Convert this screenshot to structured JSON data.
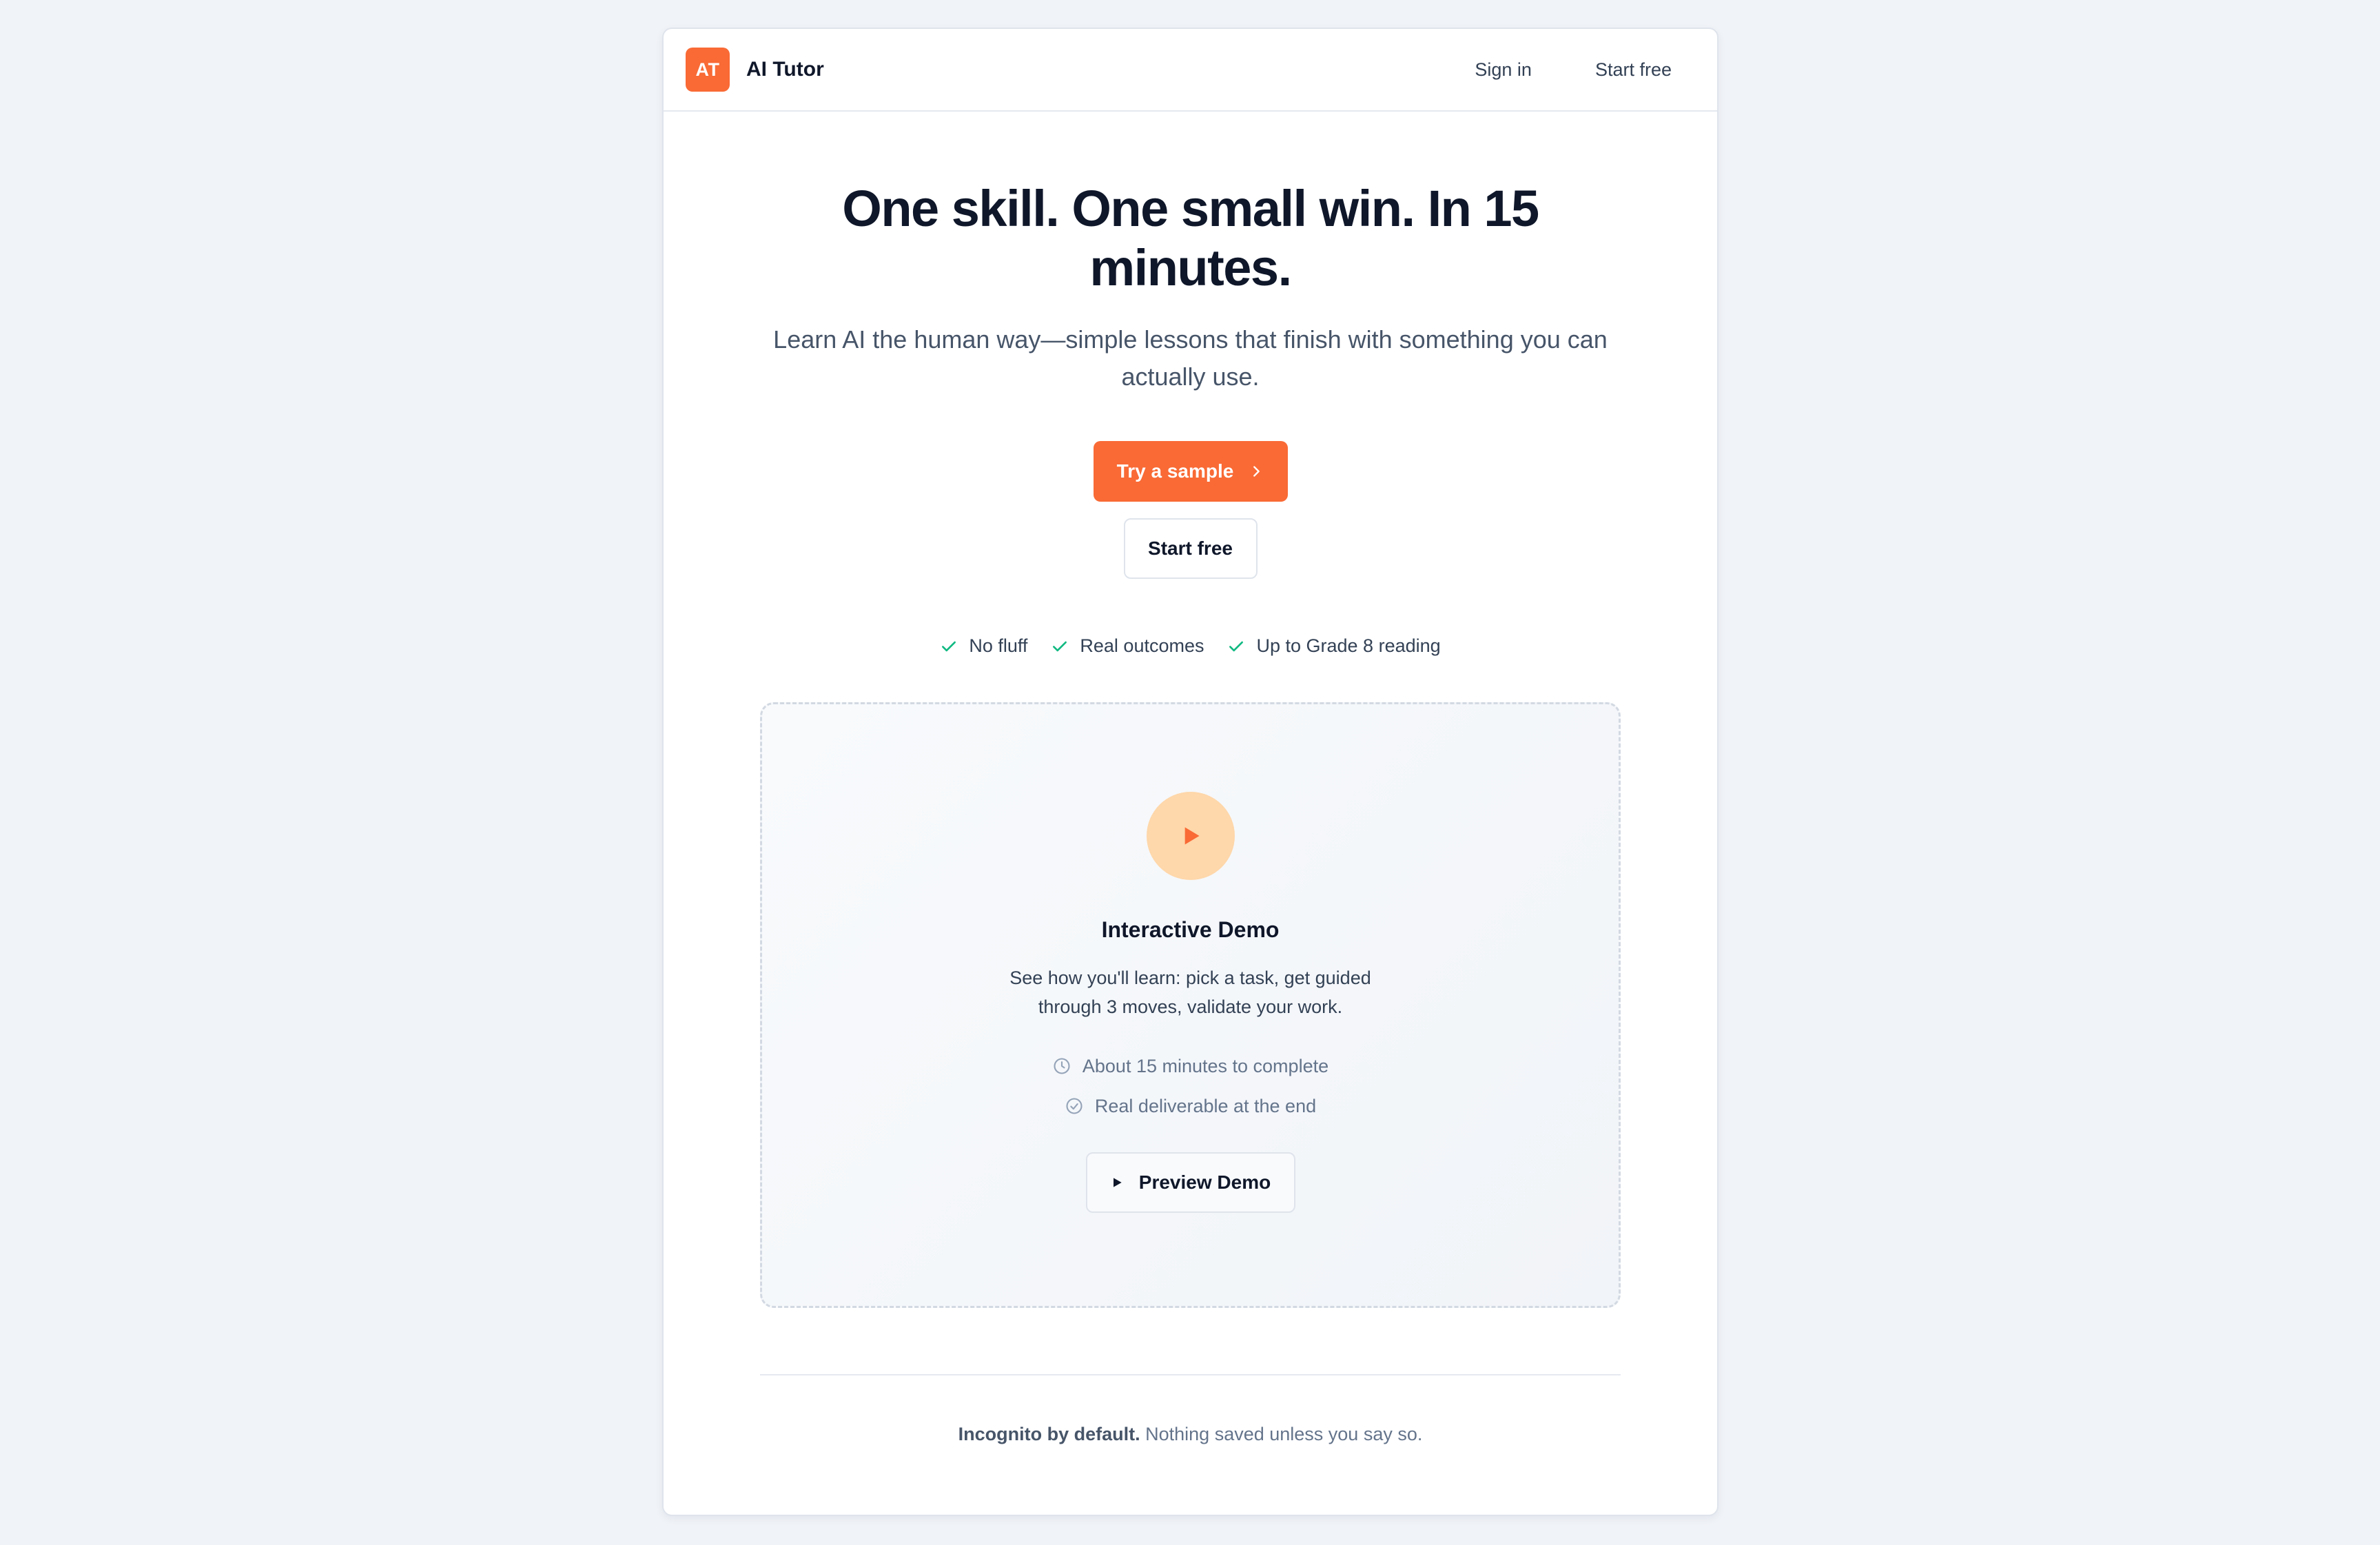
{
  "header": {
    "logo_text": "AT",
    "brand_name": "AI Tutor",
    "sign_in_label": "Sign in",
    "start_free_label": "Start free"
  },
  "hero": {
    "headline": "One skill. One small win. In 15 minutes.",
    "subheadline": "Learn AI the human way—simple lessons that finish with something you can actually use.",
    "primary_cta_label": "Try a sample",
    "secondary_cta_label": "Start free"
  },
  "features": [
    {
      "label": "No fluff",
      "icon": "check-icon"
    },
    {
      "label": "Real outcomes",
      "icon": "check-icon"
    },
    {
      "label": "Up to Grade 8 reading",
      "icon": "check-icon"
    }
  ],
  "demo": {
    "title": "Interactive Demo",
    "description": "See how you'll learn: pick a task, get guided through 3 moves, validate your work.",
    "meta": [
      {
        "label": "About 15 minutes to complete",
        "icon": "clock-icon"
      },
      {
        "label": "Real deliverable at the end",
        "icon": "check-circle-icon"
      }
    ],
    "preview_button_label": "Preview Demo"
  },
  "footer": {
    "note_bold": "Incognito by default.",
    "note_rest": " Nothing saved unless you say so."
  },
  "colors": {
    "accent": "#f96a35",
    "accent_soft": "#fed7aa",
    "check_green": "#10b981",
    "page_bg": "#f0f3f8"
  }
}
